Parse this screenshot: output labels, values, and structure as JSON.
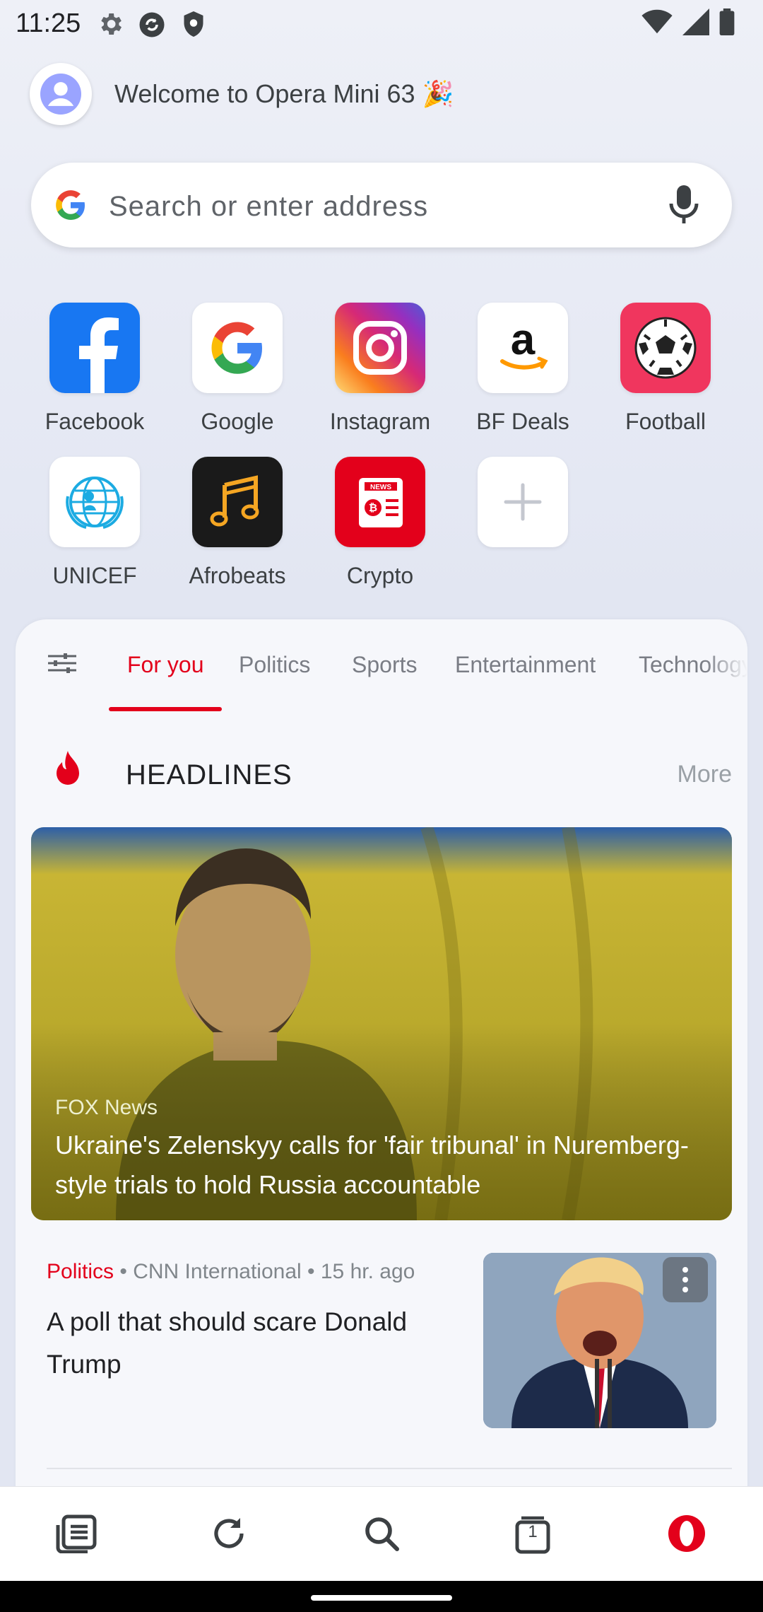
{
  "status_bar": {
    "time": "11:25",
    "icons": [
      "settings-icon",
      "sync-icon",
      "shield-icon",
      "wifi-icon",
      "signal-icon",
      "battery-icon"
    ]
  },
  "welcome": {
    "text": "Welcome to Opera Mini 63 🎉"
  },
  "search": {
    "placeholder": "Search or enter address"
  },
  "speed_dials": [
    {
      "label": "Facebook",
      "color": "#1877f2"
    },
    {
      "label": "Google",
      "color": "#ffffff"
    },
    {
      "label": "Instagram",
      "color": "#d62976"
    },
    {
      "label": "BF Deals",
      "color": "#ffffff"
    },
    {
      "label": "Football",
      "color": "#f0365e"
    },
    {
      "label": "UNICEF",
      "color": "#ffffff"
    },
    {
      "label": "Afrobeats",
      "color": "#1a1a1a"
    },
    {
      "label": "Crypto",
      "color": "#e3001b"
    },
    {
      "label": "",
      "icon": "add-icon"
    }
  ],
  "feed": {
    "tabs": [
      "For you",
      "Politics",
      "Sports",
      "Entertainment",
      "Technology"
    ],
    "active_tab": "For you",
    "section_title": "HEADLINES",
    "more_label": "More",
    "hero": {
      "source": "FOX News",
      "headline": "Ukraine's Zelenskyy calls for 'fair tribunal' in Nuremberg-style trials to hold Russia accountable"
    },
    "stories": [
      {
        "category": "Politics",
        "source": "CNN International",
        "age": "15 hr. ago",
        "headline": "A poll that should scare Donald Trump"
      }
    ]
  },
  "bottom_bar": [
    "news-icon",
    "reload-icon",
    "search-icon",
    "tabs-icon",
    "opera-menu-icon"
  ],
  "tab_count": "1",
  "colors": {
    "accent": "#e3001b",
    "background": "#e8ebf5"
  }
}
